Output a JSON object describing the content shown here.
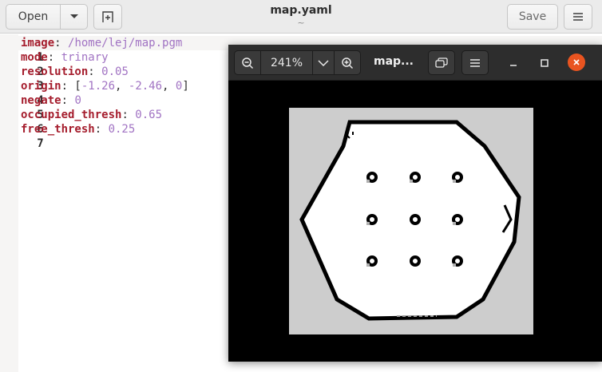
{
  "gedit": {
    "open_label": "Open",
    "save_label": "Save",
    "title": "map.yaml",
    "subtitle": "~"
  },
  "editor": {
    "lines": [
      {
        "num": "1",
        "key": "image",
        "value": "/home/lej/map.pgm"
      },
      {
        "num": "2",
        "key": "mode",
        "value": "trinary"
      },
      {
        "num": "3",
        "key": "resolution",
        "value": "0.05"
      },
      {
        "num": "4",
        "key": "origin",
        "v1": "-1.26",
        "v2": "-2.46",
        "v3": "0"
      },
      {
        "num": "5",
        "key": "negate",
        "value": "0"
      },
      {
        "num": "6",
        "key": "occupied_thresh",
        "value": "0.65"
      },
      {
        "num": "7",
        "key": "free_thresh",
        "value": "0.25"
      }
    ]
  },
  "viewer": {
    "zoom": "241%",
    "title": "map..."
  },
  "colors": {
    "key": "#a51d2d",
    "value": "#a173c3",
    "close_button": "#e95420"
  },
  "icons": [
    "chevron-down-icon",
    "new-tab-icon",
    "hamburger-menu-icon",
    "zoom-out-icon",
    "zoom-in-icon",
    "slideshow-icon",
    "minimize-icon",
    "maximize-icon",
    "close-icon"
  ]
}
